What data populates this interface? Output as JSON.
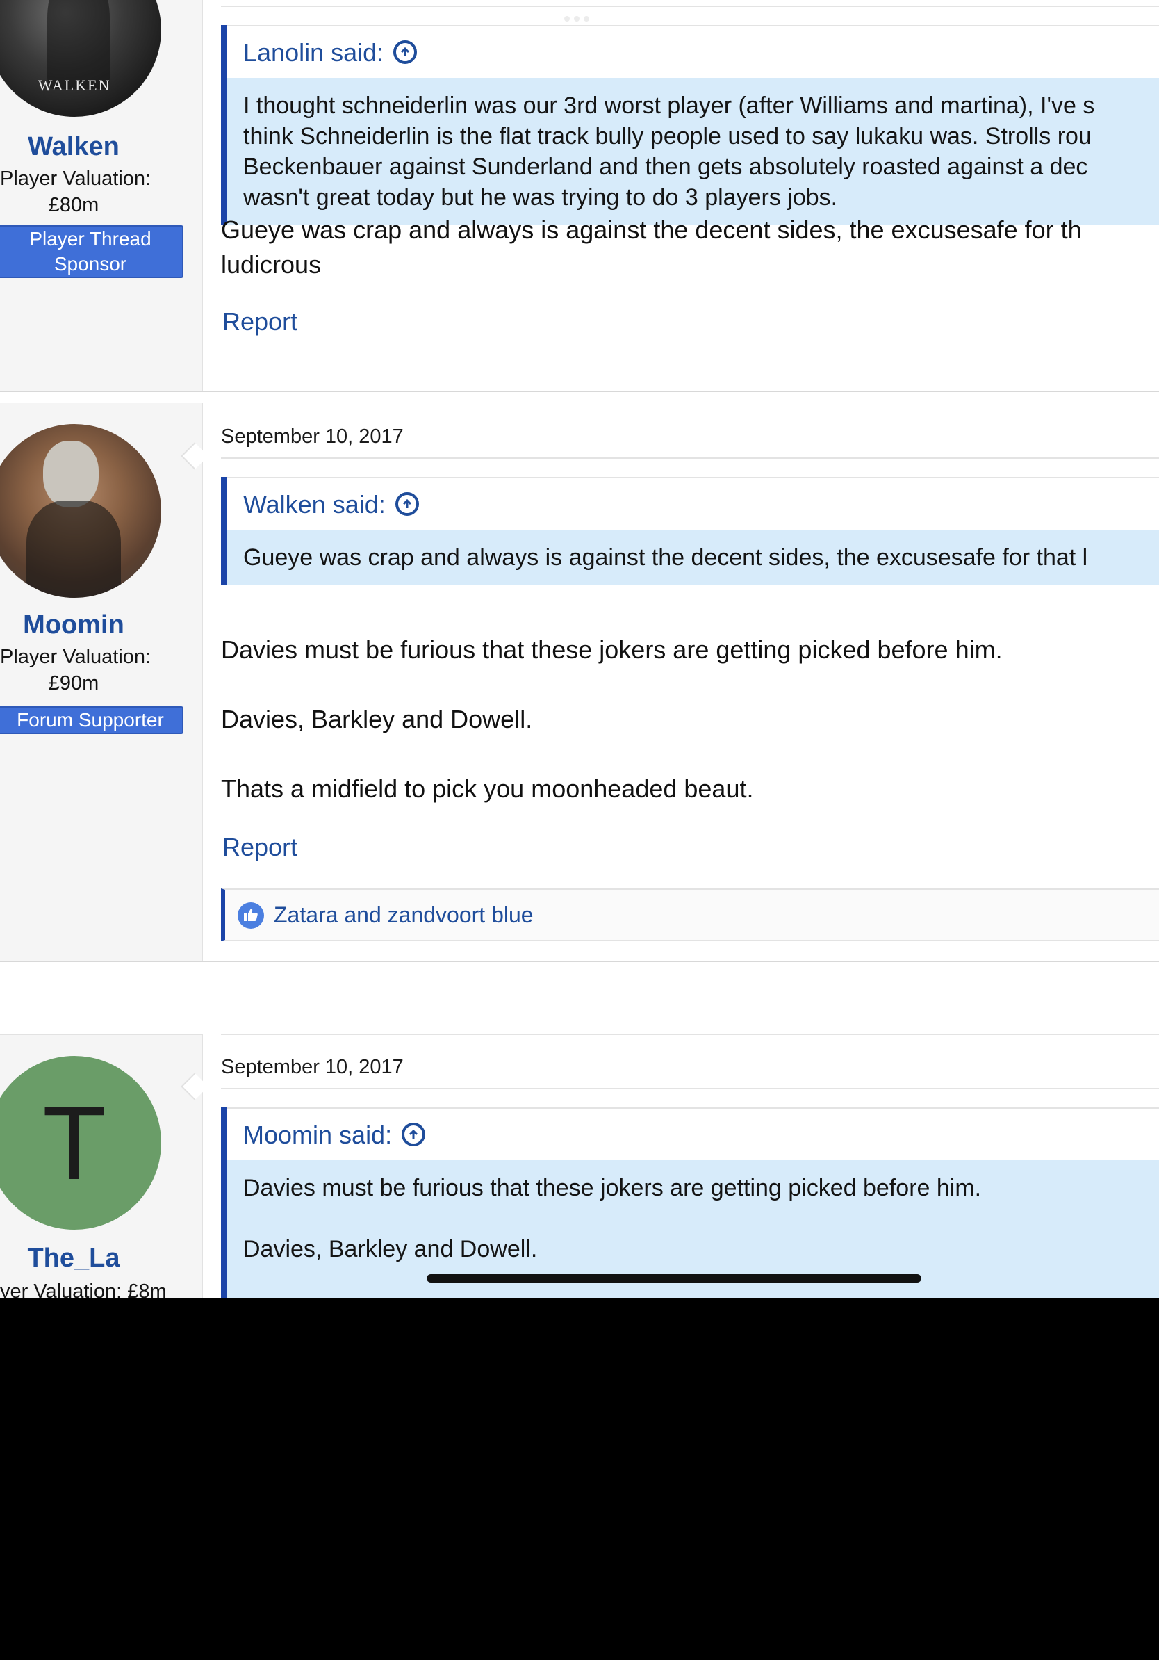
{
  "posts": [
    {
      "user": {
        "name": "Walken",
        "valuation_label": "Player Valuation:",
        "valuation": "£80m",
        "badge_line1": "Player Thread",
        "badge_line2": "Sponsor",
        "avatar_caption": "WALKEN"
      },
      "quote": {
        "author": "Lanolin said:",
        "lines": [
          "I thought schneiderlin was our 3rd worst player (after Williams and martina), I've s",
          "think Schneiderlin is the flat track bully people used to say lukaku was. Strolls rou",
          "Beckenbauer against Sunderland and then gets absolutely roasted against a dec",
          "wasn't great today but he was trying to do 3 players jobs."
        ]
      },
      "message": [
        "Gueye was crap and always is against the decent sides, the excusesafe for th",
        "ludicrous"
      ],
      "report": "Report"
    },
    {
      "date": "September 10, 2017",
      "user": {
        "name": "Moomin",
        "valuation_label": "Player Valuation:",
        "valuation": "£90m",
        "badge": "Forum Supporter"
      },
      "quote": {
        "author": "Walken said:",
        "lines": [
          "Gueye was crap and always is against the decent sides, the excusesafe for that l"
        ]
      },
      "message": [
        "Davies must be furious that these jokers are getting picked before him.",
        "Davies, Barkley and Dowell.",
        "Thats a midfield to pick you moonheaded beaut."
      ],
      "report": "Report",
      "likes": "Zatara and zandvoort blue"
    },
    {
      "date": "September 10, 2017",
      "user": {
        "name": "The_La",
        "valuation_line": "yer Valuation: £8m",
        "avatar_letter": "T"
      },
      "quote": {
        "author": "Moomin said:",
        "lines": [
          "Davies must be furious that these jokers are getting picked before him.",
          "Davies, Barkley and Dowell."
        ]
      }
    }
  ]
}
